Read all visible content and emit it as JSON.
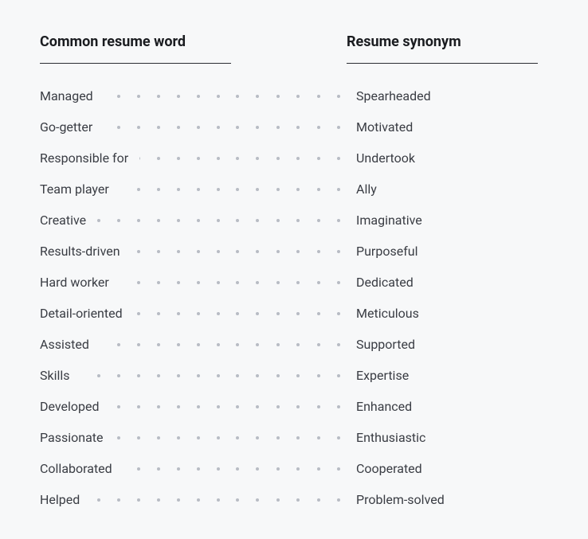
{
  "headers": {
    "left": "Common resume word",
    "right": "Resume synonym"
  },
  "rows": [
    {
      "common": "Managed",
      "synonym": "Spearheaded"
    },
    {
      "common": "Go-getter",
      "synonym": "Motivated"
    },
    {
      "common": "Responsible for",
      "synonym": "Undertook"
    },
    {
      "common": "Team player",
      "synonym": "Ally"
    },
    {
      "common": "Creative",
      "synonym": "Imaginative"
    },
    {
      "common": "Results-driven",
      "synonym": "Purposeful"
    },
    {
      "common": "Hard worker",
      "synonym": "Dedicated"
    },
    {
      "common": "Detail-oriented",
      "synonym": "Meticulous"
    },
    {
      "common": "Assisted",
      "synonym": "Supported"
    },
    {
      "common": "Skills",
      "synonym": "Expertise"
    },
    {
      "common": "Developed",
      "synonym": "Enhanced"
    },
    {
      "common": "Passionate",
      "synonym": "Enthusiastic"
    },
    {
      "common": "Collaborated",
      "synonym": "Cooperated"
    },
    {
      "common": "Helped",
      "synonym": "Problem-solved"
    }
  ]
}
